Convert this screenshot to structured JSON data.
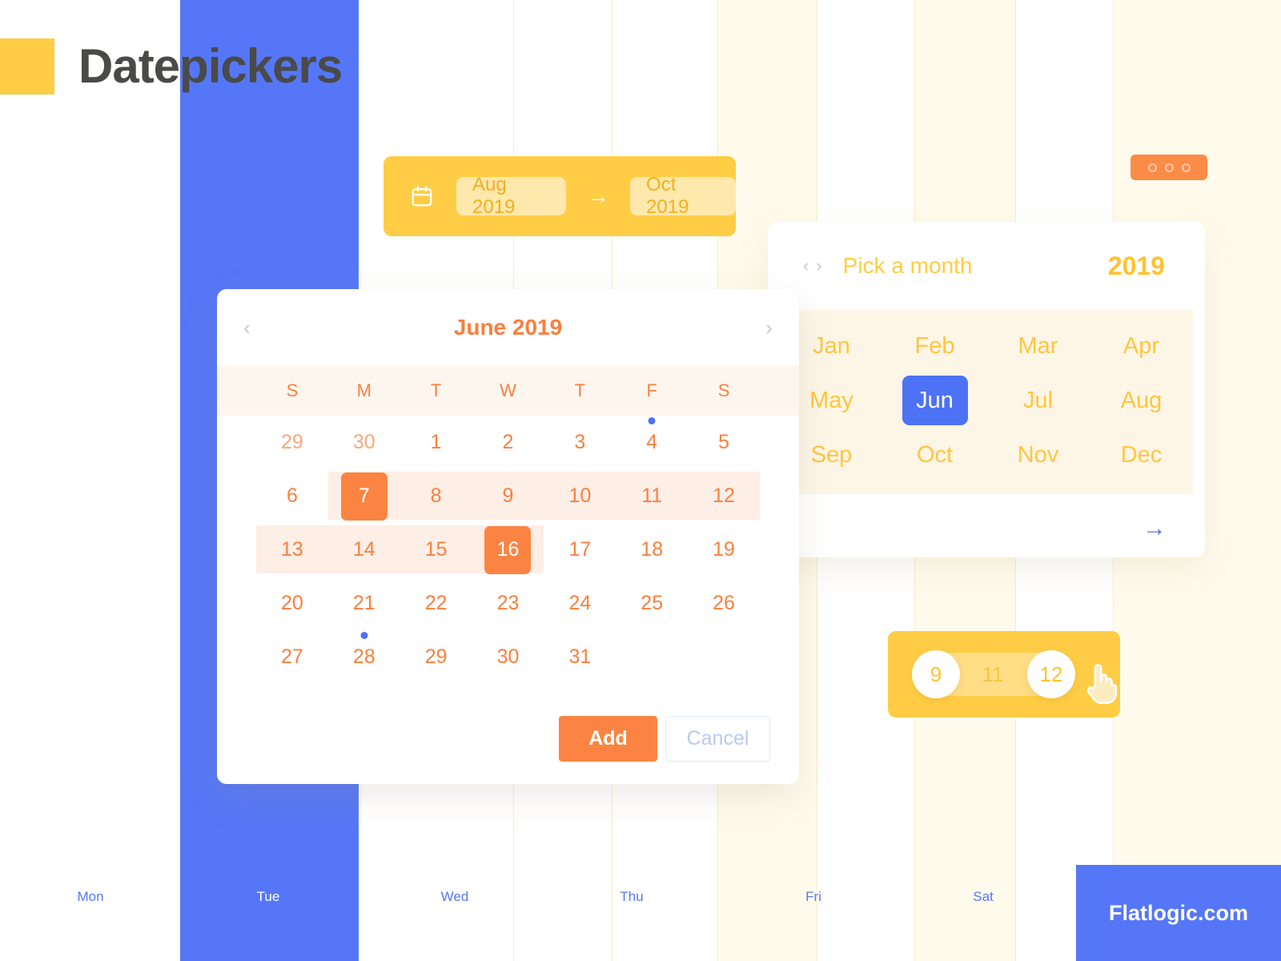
{
  "page": {
    "title": "Datepickers",
    "brand": "Flatlogic.com",
    "accent_blue": "#5577f7",
    "accent_yellow": "#ffcd45",
    "accent_orange": "#fb8442"
  },
  "range_bar": {
    "icon": "calendar-icon",
    "from": "Aug 2019",
    "arrow": "→",
    "to": "Oct 2019"
  },
  "dots_badge": {
    "icon": "three-dots-icon"
  },
  "month_panel": {
    "prev": "‹",
    "next": "›",
    "heading": "Pick a month",
    "year": "2019",
    "months": [
      "Jan",
      "Feb",
      "Mar",
      "Apr",
      "May",
      "Jun",
      "Jul",
      "Aug",
      "Sep",
      "Oct",
      "Nov",
      "Dec"
    ],
    "selected_month": "Jun",
    "next_arrow": "→"
  },
  "calendar": {
    "prev": "‹",
    "next": "›",
    "title": "June 2019",
    "weekdays": [
      "S",
      "M",
      "T",
      "W",
      "T",
      "F",
      "S"
    ],
    "rows": [
      [
        {
          "d": "29",
          "muted": true
        },
        {
          "d": "30",
          "muted": true
        },
        {
          "d": "1"
        },
        {
          "d": "2"
        },
        {
          "d": "3"
        },
        {
          "d": "4",
          "dot": true
        },
        {
          "d": "5"
        }
      ],
      [
        {
          "d": "6"
        },
        {
          "d": "7",
          "selected": true
        },
        {
          "d": "8"
        },
        {
          "d": "9"
        },
        {
          "d": "10"
        },
        {
          "d": "11"
        },
        {
          "d": "12"
        }
      ],
      [
        {
          "d": "13"
        },
        {
          "d": "14"
        },
        {
          "d": "15"
        },
        {
          "d": "16",
          "selected": true
        },
        {
          "d": "17"
        },
        {
          "d": "18"
        },
        {
          "d": "19"
        }
      ],
      [
        {
          "d": "20"
        },
        {
          "d": "21"
        },
        {
          "d": "22"
        },
        {
          "d": "23"
        },
        {
          "d": "24"
        },
        {
          "d": "25"
        },
        {
          "d": "26"
        }
      ],
      [
        {
          "d": "27"
        },
        {
          "d": "28",
          "dot": true
        },
        {
          "d": "29"
        },
        {
          "d": "30"
        },
        {
          "d": "31"
        },
        {
          "d": ""
        },
        {
          "d": ""
        }
      ]
    ],
    "range_start": "7",
    "range_end": "16",
    "add_label": "Add",
    "cancel_label": "Cancel"
  },
  "slider": {
    "min_value": "9",
    "mid_value": "11",
    "max_value": "12",
    "cursor": "hand-pointer-icon"
  },
  "footer": {
    "days": [
      "Mon",
      "Tue",
      "Wed",
      "Thu",
      "Fri",
      "Sat"
    ]
  }
}
